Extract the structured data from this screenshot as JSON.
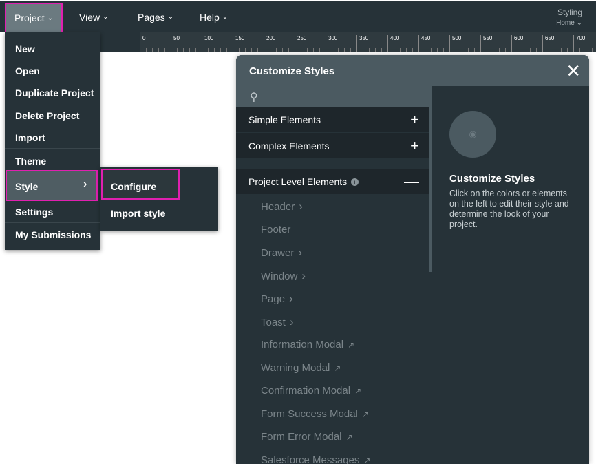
{
  "topbar": {
    "menus": [
      {
        "label": "Project"
      },
      {
        "label": "View"
      },
      {
        "label": "Pages"
      },
      {
        "label": "Help"
      }
    ],
    "context_title": "Styling",
    "context_page": "Home"
  },
  "ruler": {
    "ticks": [
      "0",
      "50",
      "100",
      "150",
      "200",
      "250",
      "300",
      "350",
      "400",
      "450",
      "500",
      "550",
      "600",
      "650",
      "700"
    ]
  },
  "project_menu": {
    "items": [
      "New",
      "Open",
      "Duplicate Project",
      "Delete Project",
      "Import",
      "Theme",
      "Style",
      "Settings",
      "My Submissions"
    ]
  },
  "style_submenu": {
    "items": [
      "Configure",
      "Import style"
    ]
  },
  "modal": {
    "title": "Customize Styles",
    "search_placeholder": "",
    "sections": {
      "simple": "Simple Elements",
      "complex": "Complex Elements",
      "project": "Project Level Elements"
    },
    "project_items": [
      {
        "label": "Header",
        "suffix": "chevron"
      },
      {
        "label": "Footer",
        "suffix": ""
      },
      {
        "label": "Drawer",
        "suffix": "chevron"
      },
      {
        "label": "Window",
        "suffix": "chevron"
      },
      {
        "label": "Page",
        "suffix": "chevron"
      },
      {
        "label": "Toast",
        "suffix": "chevron"
      },
      {
        "label": "Information Modal",
        "suffix": "external"
      },
      {
        "label": "Warning Modal",
        "suffix": "external"
      },
      {
        "label": "Confirmation Modal",
        "suffix": "external"
      },
      {
        "label": "Form Success Modal",
        "suffix": "external"
      },
      {
        "label": "Form Error Modal",
        "suffix": "external"
      },
      {
        "label": "Salesforce Messages",
        "suffix": "external"
      }
    ],
    "panel_title": "Customize Styles",
    "panel_text": "Click on the colors or elements on the left to edit their style and determine the look of your project."
  },
  "colors": {
    "highlight": "#e020b0",
    "bar": "#263238",
    "guide": "#e0207a"
  }
}
